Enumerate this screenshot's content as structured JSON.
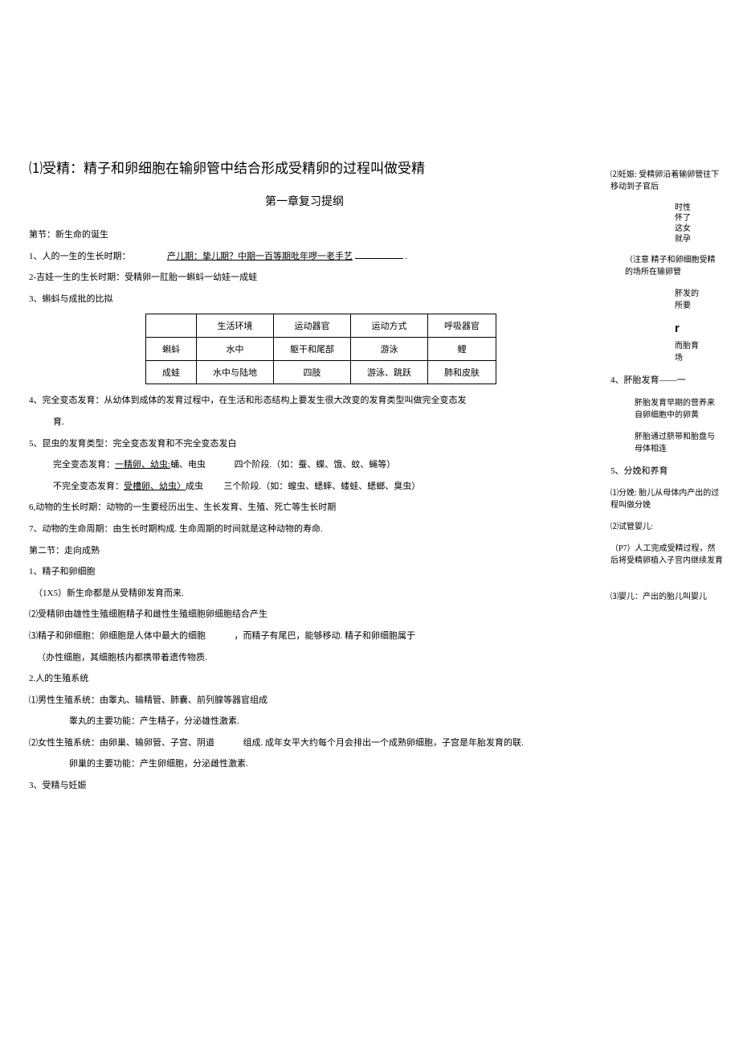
{
  "big_title": "⑴受精：精子和卵细胞在输卵管中结合形成受精卵的过程叫做受精",
  "center_title": "第一章复习提纲",
  "main": {
    "sec1_title": "第节：新生命的诞生",
    "p1_label": "1、人的一生的生长时期：",
    "p1_value": "产儿期：挚儿期？中期一百等期吡年啰一老手艺",
    "p1_tail": ".",
    "p2": "2-吉娃一生的生长时期：受精卵一肛胎一蝌蚪一幼娃一成蛙",
    "p3": "3、蝌蚪与成批的比拟",
    "table": {
      "headers": [
        "",
        "生活环境",
        "运动器官",
        "运动方式",
        "呼吸器官"
      ],
      "rows": [
        [
          "蝌蚪",
          "水中",
          "躯干和尾部",
          "游泳",
          "鲤"
        ],
        [
          "成蛙",
          "水中与陆地",
          "四肢",
          "游泳、跳跃",
          "肺和皮肤"
        ]
      ]
    },
    "p4_a": "4、完全变态发育：从幼体到成体的发育过程中，在生活和形态结构上要发生很大改变的发育类型叫做完全变态发",
    "p4_b": "育.",
    "p5_a": "5、昆虫的发育类型：完全变态发育和不完全变态发白",
    "p5_b_prefix": "完全变态发育：",
    "p5_b_u": "一精卵、幼虫:",
    "p5_b_mid": "蛹、电虫",
    "p5_b_suffix": "四个阶段.（如：蚕、蝶、饿、蚊、蝇等）",
    "p5_c_prefix": "不完全变态发育：",
    "p5_c_u": "受槽卵、幼虫〉",
    "p5_c_mid": "成虫",
    "p5_c_suffix": "三个阶段.（如：蝗虫、蟋蟀、蝼蛙、蟋螂、臭虫）",
    "p6": "6,动物的生长时期：动物的一生要经历出生、生长发育、生殖、死亡等生长时期",
    "p7": "7、动物的生命周期：由生长时期构成. 生命周期的时间就是这种动物的寿命.",
    "sec2_title": "第二节：走向成熟",
    "s2_p1": "1、精子和卵细胞",
    "s2_p1a": "（1X5）新生命都是从受精卵发育而来.",
    "s2_p1b": "⑵受精卵由雄性生殖细胞精子和雌性生殖细胞卵细胞结合产生",
    "s2_p1c_a": "⑶精子和卵细胞：卵细胞是人体中最大的细胞",
    "s2_p1c_b": "，而精子有尾巴，能够移动. 精子和卵细胞属于",
    "s2_p1c_c": "（办性细胞，其细胞核内都携带着遗传物质.",
    "s2_p2": "2.人的生殖系统",
    "s2_p2a": "⑴男性生殖系统：由睾丸、输精管、肺囊、前列腺等器官组成",
    "s2_p2a_2": "睾丸的主要功能：产生精子，分泌雄性激素.",
    "s2_p2b_a": "⑵女性生殖系统：由卵巢、输卵管、子宫、阴道",
    "s2_p2b_b": "组成. 成年女平大约每个月会排出一个成熟卵细胞，子宫是年胎发育的联.",
    "s2_p2b_2": "卵巢的主要功能：产生卵细胞，分泌雌性激素.",
    "s2_p3": "3、受精与妊娠"
  },
  "side": {
    "b1": "⑵妊娠: 受精卵沿着输卵管往下移动到子官后",
    "b1_sub": "时性\n怀了\n这女\n就孕",
    "b2": "（注意 精子和卵细胞受精的场所在输卵管",
    "b3": "肧发的所要",
    "r": "r",
    "b4": "而胎育场",
    "b5": "4、肧胎发育——一",
    "b5_a": "肧胎发育早期的营养来自卵细胞中的卵黄",
    "b5_b": "肧胎通过脐带和胎盘与母体相连",
    "b6": "5、分娩和养育",
    "b6_a": "⑴分娩: 胎儿从母体内产出的过程叫做分娩",
    "b6_b": "⑵试管婴儿:",
    "b6_c": "（P7）人工完成受精过程，然后将受精卵植入子宫内继续发育",
    "b6_d": "⑶婴儿：产出的胎儿叫婴儿"
  }
}
